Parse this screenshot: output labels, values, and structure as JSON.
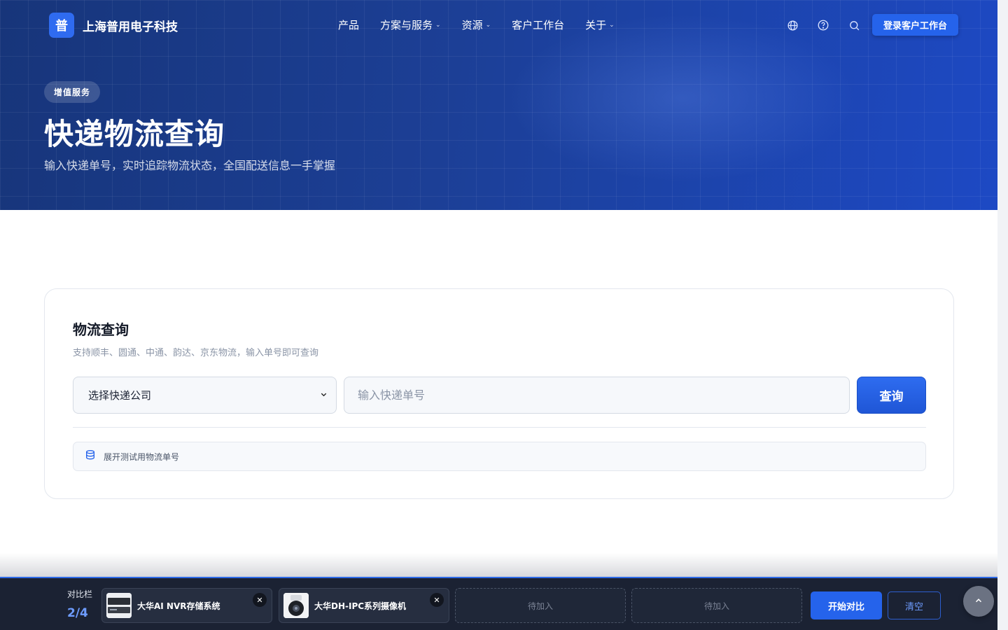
{
  "brand": {
    "logo_char": "普",
    "name": "上海普用电子科技"
  },
  "nav": {
    "items": [
      {
        "label": "产品",
        "dropdown": false
      },
      {
        "label": "方案与服务",
        "dropdown": true
      },
      {
        "label": "资源",
        "dropdown": true
      },
      {
        "label": "客户工作台",
        "dropdown": false
      },
      {
        "label": "关于",
        "dropdown": true
      }
    ],
    "icons": [
      "globe-icon",
      "help-circle-icon",
      "search-icon"
    ],
    "login_label": "登录客户工作台"
  },
  "hero": {
    "badge": "增值服务",
    "title": "快递物流查询",
    "subtitle": "输入快递单号，实时追踪物流状态，全国配送信息一手掌握"
  },
  "query": {
    "title": "物流查询",
    "subtitle": "支持顺丰、圆通、中通、韵达、京东物流，输入单号即可查询",
    "select_value": "选择快递公司",
    "input_placeholder": "输入快递单号",
    "input_value": "",
    "button_label": "查询",
    "expand_label": "展开测试用物流单号"
  },
  "compare": {
    "label": "对比栏",
    "count": "2/4",
    "slots": [
      {
        "name": "大华AI NVR存储系统",
        "filled": true
      },
      {
        "name": "大华DH-IPC系列摄像机",
        "filled": true
      },
      {
        "name": "待加入",
        "filled": false
      },
      {
        "name": "待加入",
        "filled": false
      }
    ],
    "start_label": "开始对比",
    "clear_label": "清空"
  },
  "colors": {
    "primary": "#2563eb",
    "hero_dark": "#17357a",
    "bar_bg": "#1b2233"
  }
}
